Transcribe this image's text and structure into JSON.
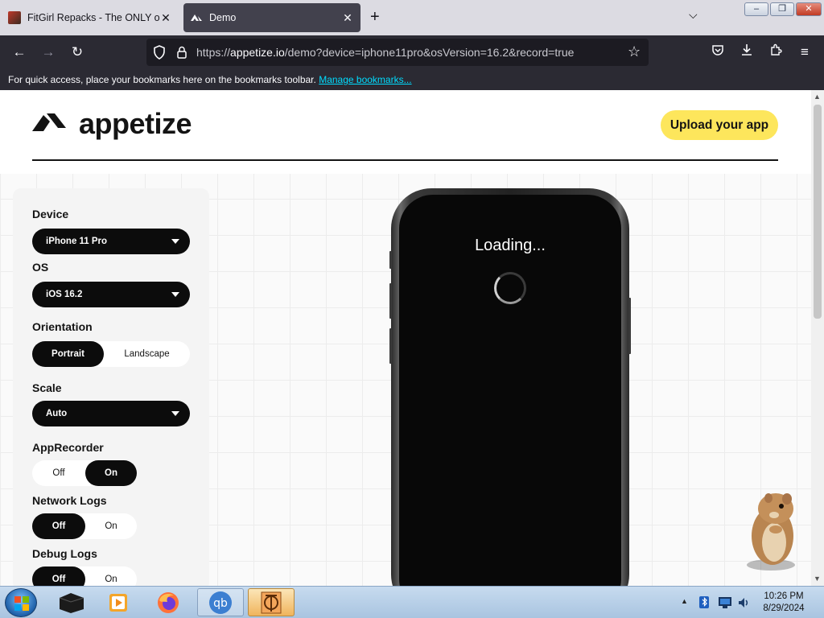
{
  "browser": {
    "tabs": [
      {
        "title": "FitGirl Repacks - The ONLY official site",
        "active": false
      },
      {
        "title": "Demo",
        "active": true
      }
    ],
    "new_tab_label": "+",
    "url": {
      "prefix": "https://",
      "host": "appetize.io",
      "path": "/demo?device=iphone11pro&osVersion=16.2&record=true"
    },
    "bookmarks_bar": {
      "message": "For quick access, place your bookmarks here on the bookmarks toolbar.",
      "link": "Manage bookmarks..."
    }
  },
  "page": {
    "logo_text": "appetize",
    "upload_button": "Upload your app",
    "settings": {
      "device": {
        "label": "Device",
        "value": "iPhone 11 Pro"
      },
      "os": {
        "label": "OS",
        "value": "iOS 16.2"
      },
      "orientation": {
        "label": "Orientation",
        "options": [
          "Portrait",
          "Landscape"
        ],
        "selected": "Portrait"
      },
      "scale": {
        "label": "Scale",
        "value": "Auto"
      },
      "app_recorder": {
        "label": "AppRecorder",
        "options": [
          "Off",
          "On"
        ],
        "selected": "On"
      },
      "network_logs": {
        "label": "Network Logs",
        "options": [
          "Off",
          "On"
        ],
        "selected": "Off"
      },
      "debug_logs": {
        "label": "Debug Logs",
        "options": [
          "Off",
          "On"
        ],
        "selected": "Off"
      }
    },
    "device_screen": {
      "status_text": "Loading..."
    }
  },
  "taskbar": {
    "apps": [
      "explorer",
      "media-player",
      "firefox",
      "qbittorrent",
      "app"
    ],
    "clock": {
      "time": "10:26 PM",
      "date": "8/29/2024"
    }
  },
  "colors": {
    "accent_yellow": "#fde65c",
    "dark": "#0c0c0c",
    "browser_dark": "#2b2a33"
  }
}
